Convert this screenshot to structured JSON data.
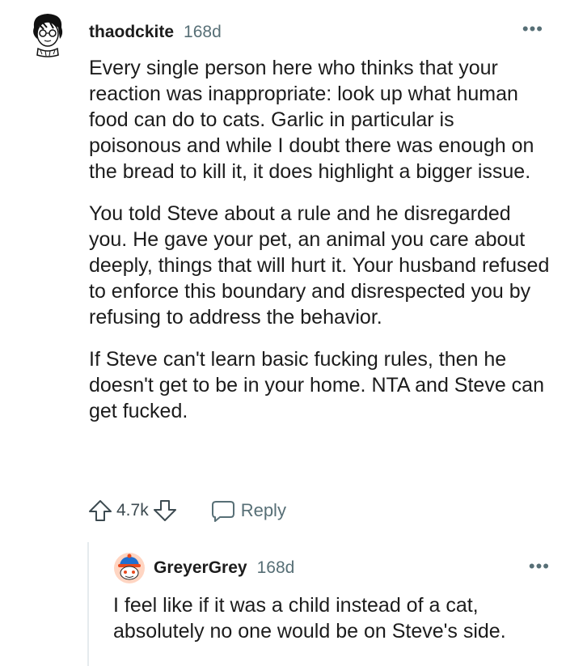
{
  "comment": {
    "username": "thaodckite",
    "age": "168d",
    "more_icon": "•••",
    "paragraphs": [
      "Every single person here who thinks that your reaction was inappropriate: look up what human food can do to cats. Garlic in particular is poisonous and while I doubt there was enough on the bread to kill it, it does highlight a bigger issue.",
      "You told Steve about a rule and he disregarded you. He gave your pet, an animal you care about deeply, things that will hurt it. Your husband refused to enforce this boundary and disrespected you by refusing to address the behavior.",
      "If Steve can't learn basic fucking rules, then he doesn't get to be in your home. NTA and Steve can get fucked."
    ],
    "score": "4.7k",
    "reply_label": "Reply"
  },
  "reply": {
    "username": "GreyerGrey",
    "age": "168d",
    "more_icon": "•••",
    "text": "I feel like if it was a child instead of a cat, absolutely no one would be on Steve's side."
  },
  "colors": {
    "text": "#1c1c1c",
    "muted": "#576f76",
    "thread_line": "#e5ebee"
  },
  "icons": [
    "avatar-drawing",
    "upvote-arrow-icon",
    "downvote-arrow-icon",
    "comment-bubble-icon",
    "more-options-icon",
    "snoo-avatar-icon"
  ]
}
